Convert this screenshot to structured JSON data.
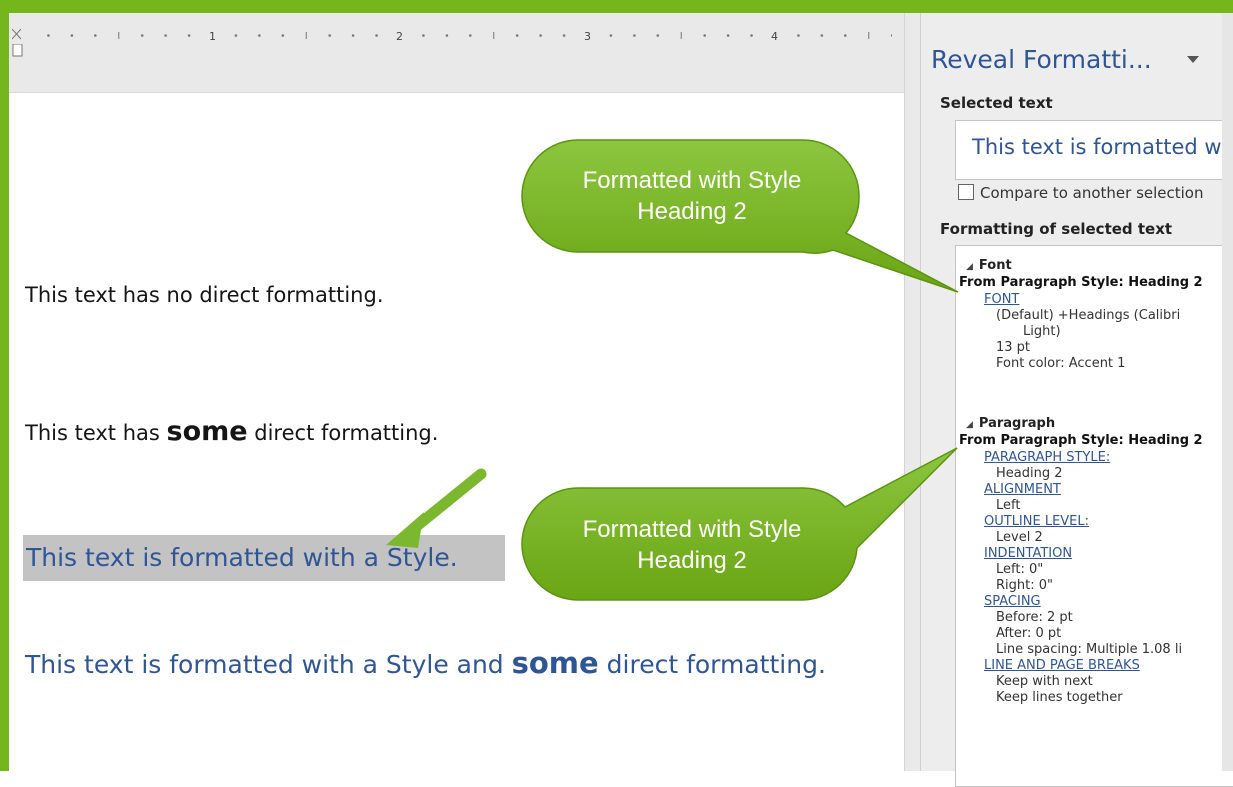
{
  "document": {
    "ruler_numbers": [
      "1",
      "2",
      "3",
      "4"
    ],
    "paragraphs": {
      "p1": "This text has no direct formatting.",
      "p2_before": "This text has ",
      "p2_bold": "some",
      "p2_after": " direct formatting.",
      "p3": "This text is formatted with a Style.",
      "p4_before": "This text is formatted with a Style and ",
      "p4_bold": "some",
      "p4_after": " direct formatting."
    }
  },
  "callouts": {
    "top": [
      "Formatted with Style",
      "Heading 2"
    ],
    "bottom": [
      "Formatted with Style",
      "Heading 2"
    ]
  },
  "panel": {
    "title": "Reveal Formatti...",
    "selected_text_label": "Selected text",
    "selected_text_preview": "This text is formatted with a Style.",
    "compare_label": "Compare to another selection",
    "formatting_label": "Formatting of selected text",
    "font_section": {
      "header": "Font",
      "from": "From Paragraph Style: Heading 2",
      "link": "FONT",
      "value1": "(Default) +Headings (Calibri",
      "value1b": "Light)",
      "value2": "13 pt",
      "value3": "Font color: Accent 1"
    },
    "paragraph_section": {
      "header": "Paragraph",
      "from": "From Paragraph Style: Heading 2",
      "style_link": "PARAGRAPH STYLE:",
      "style_value": "Heading 2",
      "align_link": "ALIGNMENT",
      "align_value": "Left",
      "outline_link": "OUTLINE LEVEL:",
      "outline_value": "Level 2",
      "indent_link": "INDENTATION",
      "indent_left": "Left:  0\"",
      "indent_right": "Right:  0\"",
      "spacing_link": "SPACING",
      "spacing_before": "Before:  2 pt",
      "spacing_after": "After:  0 pt",
      "line_spacing": "Line spacing:  Multiple 1.08 li",
      "breaks_link": "LINE AND PAGE BREAKS",
      "keep_next": "Keep with next",
      "keep_lines": "Keep lines together"
    }
  },
  "colors": {
    "accent_green": "#74b61b",
    "heading_blue": "#2f5597"
  }
}
